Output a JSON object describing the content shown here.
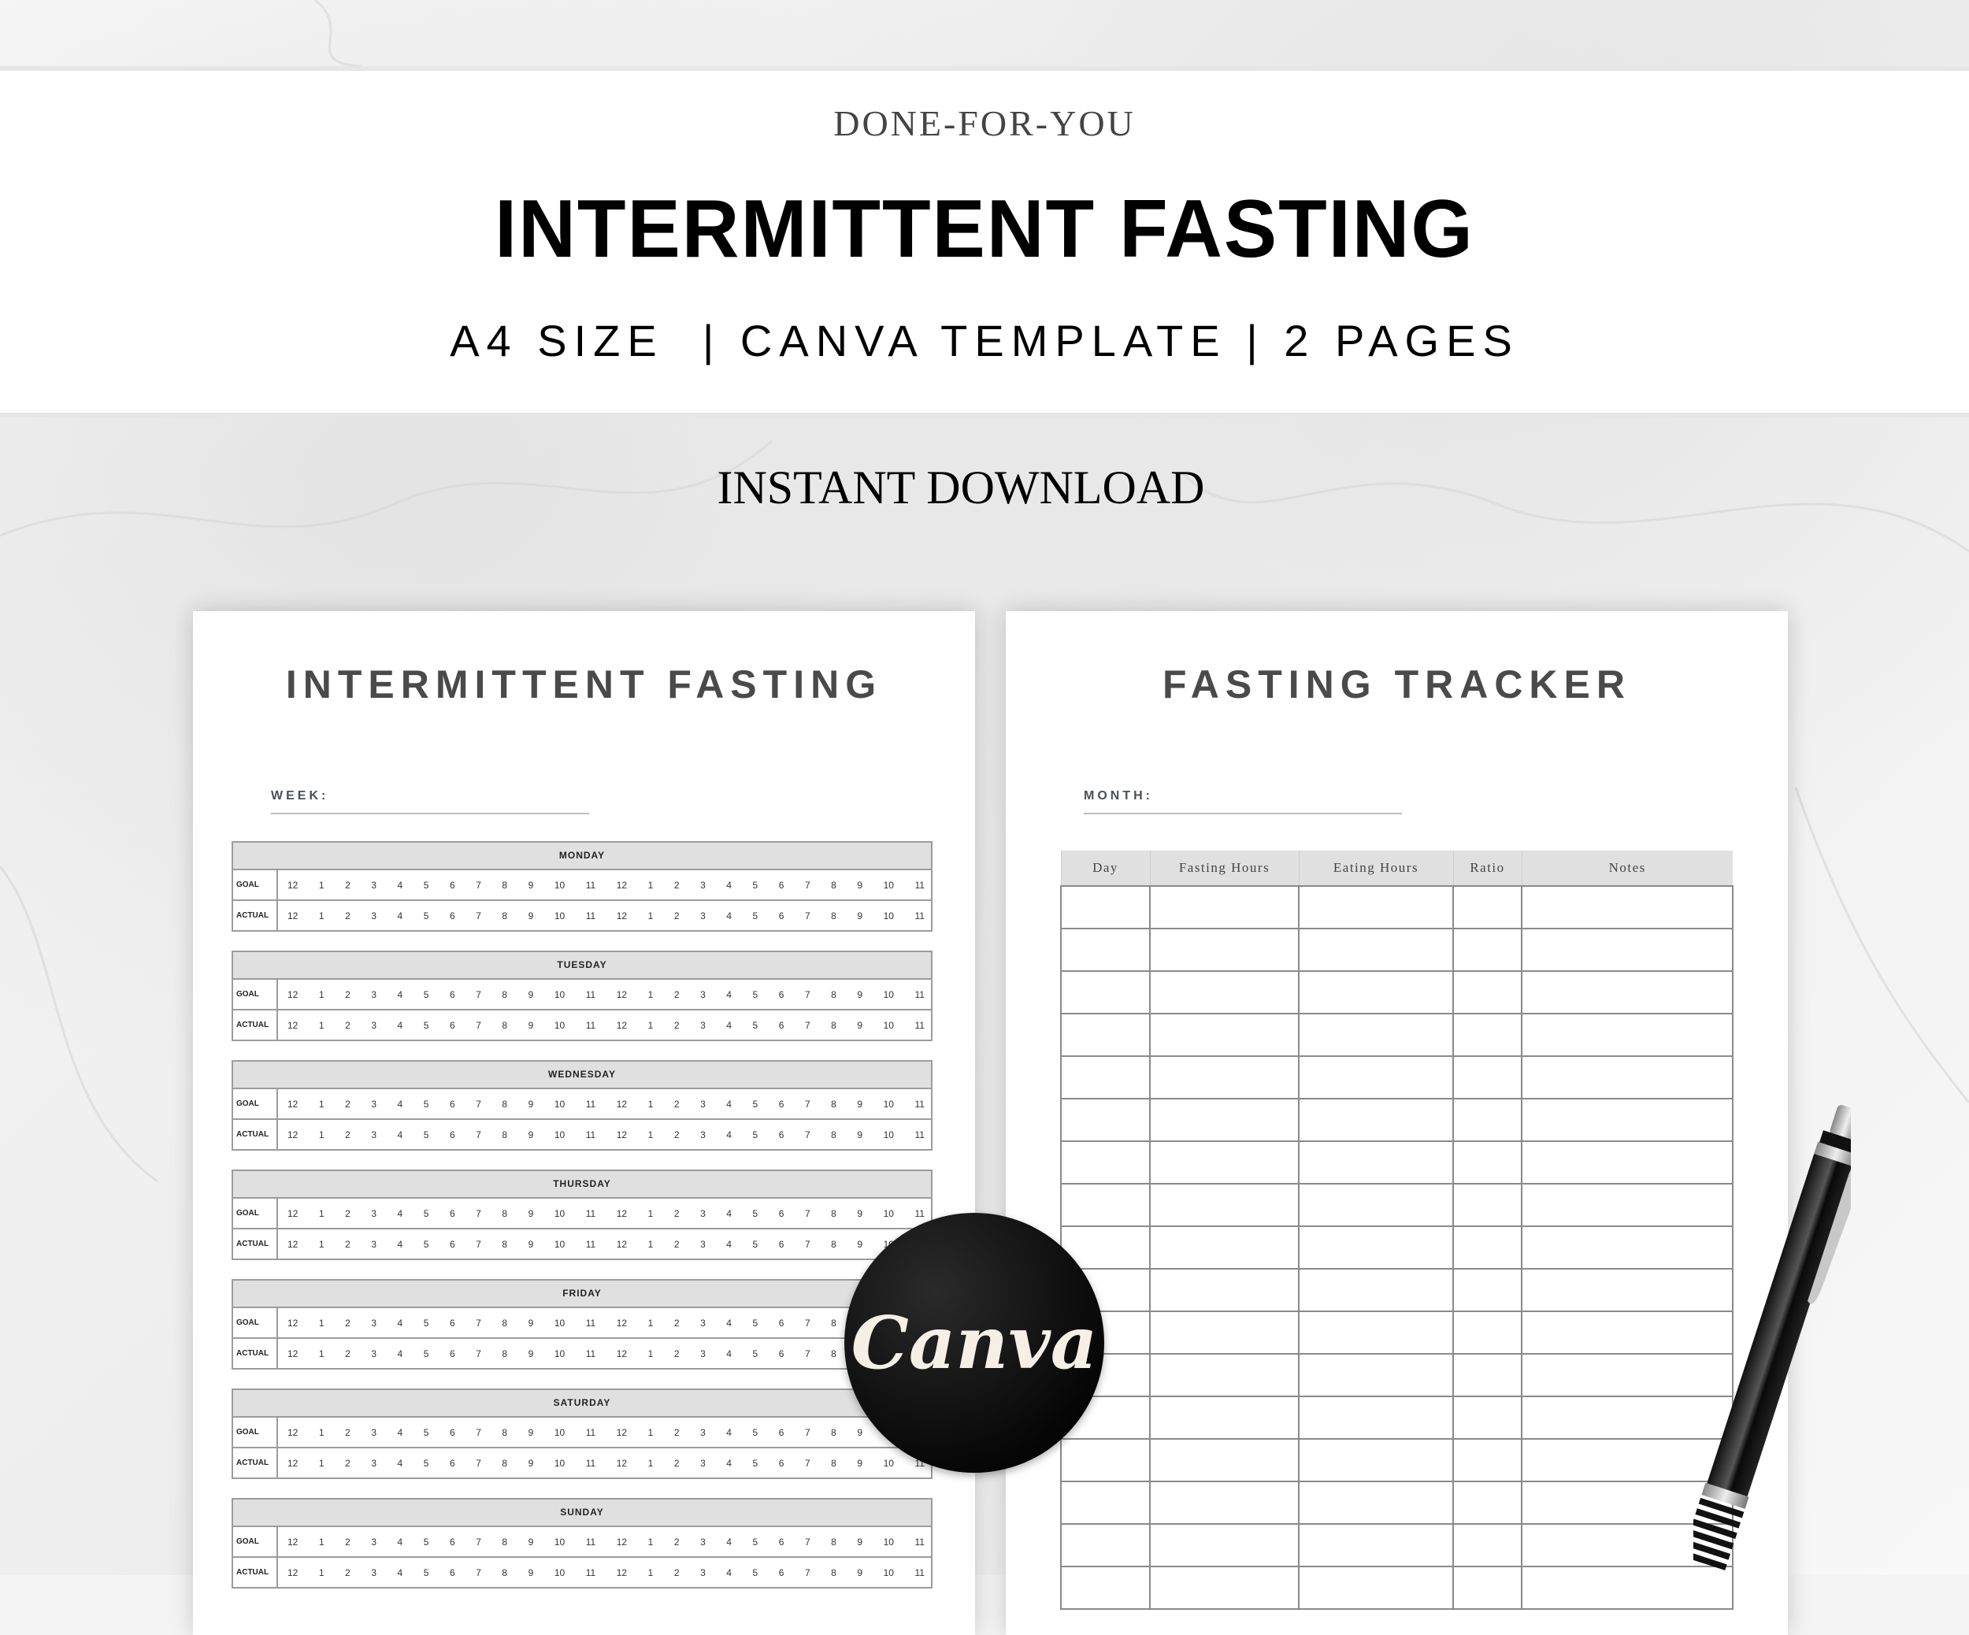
{
  "banner": {
    "kicker": "DONE-FOR-YOU",
    "headline": "INTERMITTENT FASTING",
    "subline": "A4 SIZE  | CANVA TEMPLATE | 2 PAGES"
  },
  "instant_download": "INSTANT DOWNLOAD",
  "page_left": {
    "title": "INTERMITTENT FASTING",
    "week_label": "WEEK:",
    "row_labels": {
      "goal": "GOAL",
      "actual": "ACTUAL"
    },
    "hours": [
      "12",
      "1",
      "2",
      "3",
      "4",
      "5",
      "6",
      "7",
      "8",
      "9",
      "10",
      "11",
      "12",
      "1",
      "2",
      "3",
      "4",
      "5",
      "6",
      "7",
      "8",
      "9",
      "10",
      "11"
    ],
    "days": [
      "MONDAY",
      "TUESDAY",
      "WEDNESDAY",
      "THURSDAY",
      "FRIDAY",
      "SATURDAY",
      "SUNDAY"
    ]
  },
  "page_right": {
    "title": "FASTING TRACKER",
    "month_label": "MONTH:",
    "columns": [
      "Day",
      "Fasting Hours",
      "Eating Hours",
      "Ratio",
      "Notes"
    ],
    "visible_rows": 17
  },
  "badge": {
    "label": "Canva",
    "icon": "canva-logo-icon"
  },
  "decor": {
    "pen": "pen-icon"
  }
}
